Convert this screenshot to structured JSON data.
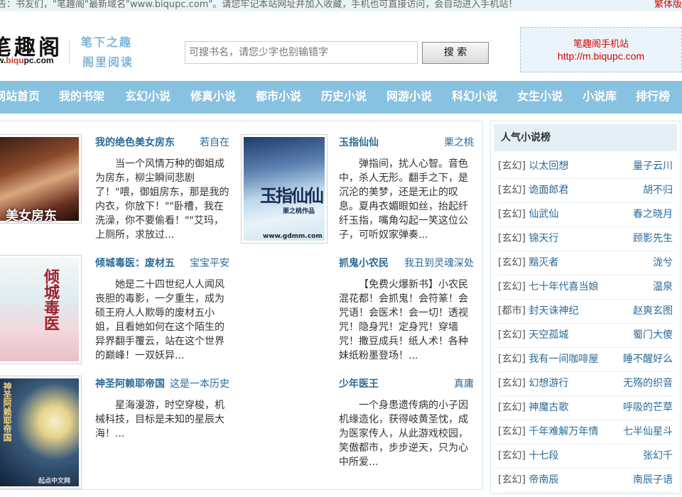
{
  "notice": {
    "text": "告：书友们，\"笔趣阁\"最新域名\"www.biqupc.com\"。请您牢记本站网址并加入收藏，手机也可直接访问，会自动进入手机站！",
    "traditional_link": "繁体版"
  },
  "header": {
    "logo_text": "笔趣阁",
    "logo_url_prefix": "w.",
    "logo_url_highlight": "biqu",
    "logo_url_suffix": "pc.com",
    "slogan_line1": "笔下之趣",
    "slogan_line2": "阁里阅读",
    "search_placeholder": "可搜书名，请您少字也别输错字",
    "search_button": "搜 索",
    "mobile_title": "笔趣阁手机站",
    "mobile_url": "http://m.biqupc.com"
  },
  "nav": {
    "items": [
      "网站首页",
      "我的书架",
      "玄幻小说",
      "修真小说",
      "都市小说",
      "历史小说",
      "网游小说",
      "科幻小说",
      "女生小说",
      "小说库",
      "排行榜"
    ]
  },
  "books": [
    {
      "title": "我的绝色美女房东",
      "author": "若自在",
      "desc": "当一个风情万种的御姐成为房东，柳尘瞬间悲剧了！\"喂，御姐房东，那是我的内衣，你放下！\"\"卧槽，我在洗澡，你不要偷看！\"\"艾玛，上厕所，求放过...",
      "cover_text": "美女房东"
    },
    {
      "title": "玉指仙仙",
      "author": "栗之桃",
      "desc": "弹指间，扰人心智。音色中，杀人无形。翻手之下，是沉沦的美梦，还是无止的叹息。夏冉衣媚眼如丝，抬起纤纤玉指，嘴角勾起一笑这位公子，可听奴家弹奏...",
      "cover_text": "玉指仙仙",
      "cover_author": "栗之桃作品",
      "cover_url": "www.gdmm.com"
    },
    {
      "title": "倾城毒医：废材五",
      "author": "宝宝平安",
      "desc": "她是二十四世纪人人闻风丧胆的毒影，一夕重生，成为硕王府人人欺辱的废材五小姐，且看她如何在这个陌生的异界翻手覆云，站在这个世界的巅峰！一双妖异...",
      "cover_text": "倾城毒医"
    },
    {
      "title": "抓鬼小农民",
      "author": "我丑到灵魂深处",
      "desc": "【免费火爆新书】小农民混花都！会抓鬼！会符篆！会咒语！会医术！会一切！透视咒！隐身咒！定身咒！穿墙咒！撒豆成兵！纸人术！各种妹纸粉墨登场！..."
    },
    {
      "title": "神圣阿赖耶帝国",
      "author": "这是一本历史",
      "desc": "星海漫游，时空穿梭，机械科技，目标是未知的星辰大海！...",
      "cover_text": "神圣阿赖耶帝国",
      "cover_footer": "起点中文网"
    },
    {
      "title": "少年医王",
      "author": "真庸",
      "desc": "一个身患遗传病的小子因机缘造化，获得岐黄圣忱，成为医家传人，从此游戏校园，笑傲都市，步步逆天，只为心中所爱..."
    }
  ],
  "sidebar": {
    "title": "人气小说榜",
    "items": [
      {
        "cat": "[玄幻]",
        "name": "以太回想",
        "author": "量子云川"
      },
      {
        "cat": "[玄幻]",
        "name": "诡面郎君",
        "author": "胡不归"
      },
      {
        "cat": "[玄幻]",
        "name": "仙武仙",
        "author": "春之晓月"
      },
      {
        "cat": "[玄幻]",
        "name": "锦天行",
        "author": "顾影先生"
      },
      {
        "cat": "[玄幻]",
        "name": "黯灭者",
        "author": "泷兮"
      },
      {
        "cat": "[玄幻]",
        "name": "七十年代喜当娘",
        "author": "温泉"
      },
      {
        "cat": "[都市]",
        "name": "封天诛神纪",
        "author": "赵爽玄图"
      },
      {
        "cat": "[玄幻]",
        "name": "天空孤城",
        "author": "蜀门大傻"
      },
      {
        "cat": "[玄幻]",
        "name": "我有一间咖啡屋",
        "author": "睡不醒好么"
      },
      {
        "cat": "[玄幻]",
        "name": "幻想游行",
        "author": "无殇的织音"
      },
      {
        "cat": "[玄幻]",
        "name": "神魔古歌",
        "author": "呼吸的芒草"
      },
      {
        "cat": "[玄幻]",
        "name": "千年难解万年情",
        "author": "七半仙星斗"
      },
      {
        "cat": "[玄幻]",
        "name": "十七段",
        "author": "张幻千"
      },
      {
        "cat": "[玄幻]",
        "name": "帝南辰",
        "author": "南辰子语"
      }
    ]
  }
}
